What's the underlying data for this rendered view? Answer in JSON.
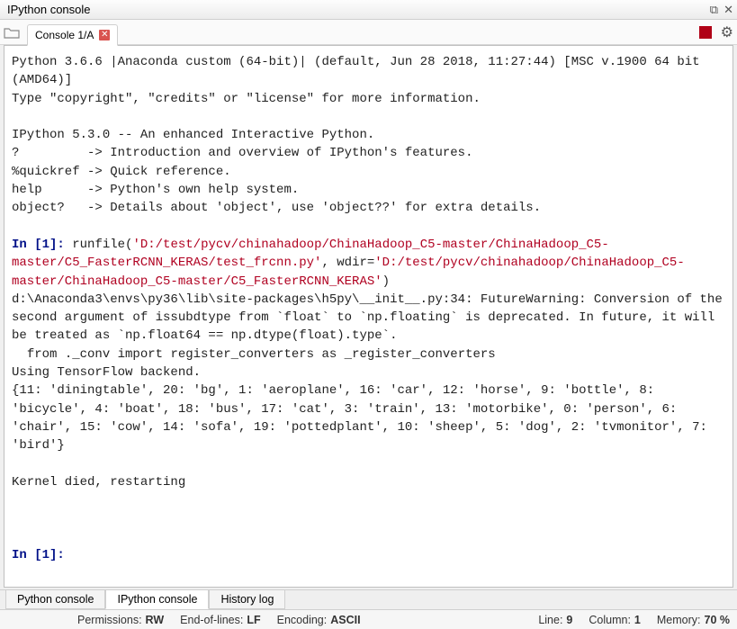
{
  "titlebar": {
    "title": "IPython console"
  },
  "toolbar": {
    "tabs": [
      {
        "label": "Console 1/A"
      }
    ]
  },
  "console": {
    "banner1": "Python 3.6.6 |Anaconda custom (64-bit)| (default, Jun 28 2018, 11:27:44) [MSC v.1900 64 bit (AMD64)]",
    "banner2": "Type \"copyright\", \"credits\" or \"license\" for more information.",
    "banner3": "IPython 5.3.0 -- An enhanced Interactive Python.",
    "help1": "?         -> Introduction and overview of IPython's features.",
    "help2": "%quickref -> Quick reference.",
    "help3": "help      -> Python's own help system.",
    "help4": "object?   -> Details about 'object', use 'object??' for extra details.",
    "prompt_in": "In [",
    "prompt_num1": "1",
    "prompt_close": "]: ",
    "runfile_pre": "runfile(",
    "runfile_path": "'D:/test/pycv/chinahadoop/ChinaHadoop_C5-master/ChinaHadoop_C5-master/C5_FasterRCNN_KERAS/test_frcnn.py'",
    "runfile_mid": ", wdir=",
    "runfile_wdir": "'D:/test/pycv/chinahadoop/ChinaHadoop_C5-master/ChinaHadoop_C5-master/C5_FasterRCNN_KERAS'",
    "runfile_post": ")",
    "warn1": "d:\\Anaconda3\\envs\\py36\\lib\\site-packages\\h5py\\__init__.py:34: FutureWarning: Conversion of the second argument of issubdtype from `float` to `np.floating` is deprecated. In future, it will be treated as `np.float64 == np.dtype(float).type`.",
    "warn2": "  from ._conv import register_converters as _register_converters",
    "out1": "Using TensorFlow backend.",
    "out2": "{11: 'diningtable', 20: 'bg', 1: 'aeroplane', 16: 'car', 12: 'horse', 9: 'bottle', 8: 'bicycle', 4: 'boat', 18: 'bus', 17: 'cat', 3: 'train', 13: 'motorbike', 0: 'person', 6: 'chair', 15: 'cow', 14: 'sofa', 19: 'pottedplant', 10: 'sheep', 5: 'dog', 2: 'tvmonitor', 7: 'bird'}",
    "kernel_msg": "Kernel died, restarting",
    "prompt_num2": "1"
  },
  "bottom_tabs": {
    "python": "Python console",
    "ipython": "IPython console",
    "history": "History log"
  },
  "status": {
    "perm_label": "Permissions:",
    "perm_value": "RW",
    "eol_label": "End-of-lines:",
    "eol_value": "LF",
    "enc_label": "Encoding:",
    "enc_value": "ASCII",
    "line_label": "Line:",
    "line_value": "9",
    "col_label": "Column:",
    "col_value": "1",
    "mem_label": "Memory:",
    "mem_value": "70 %"
  },
  "window_controls": {
    "undock": "⧉",
    "close": "✕"
  }
}
